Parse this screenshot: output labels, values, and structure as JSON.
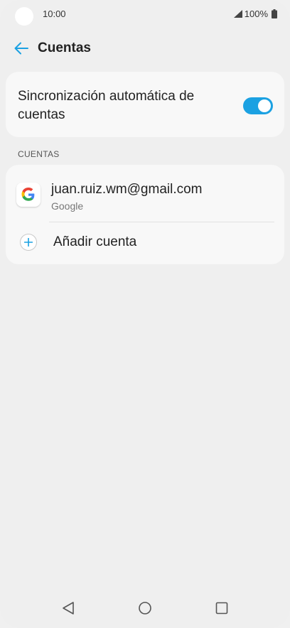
{
  "status_bar": {
    "time": "10:00",
    "battery": "100%",
    "icons": [
      "signal-icon",
      "battery-icon"
    ]
  },
  "header": {
    "title": "Cuentas",
    "back_icon": "arrow-left-icon"
  },
  "sync": {
    "label": "Sincronización automática de cuentas",
    "enabled": true
  },
  "accounts_section": {
    "header": "CUENTAS",
    "accounts": [
      {
        "email": "juan.ruiz.wm@gmail.com",
        "type": "Google",
        "icon": "google-icon"
      }
    ],
    "add_label": "Añadir cuenta"
  },
  "nav": {
    "icons": [
      "back-triangle-icon",
      "home-circle-icon",
      "recents-square-icon"
    ]
  },
  "colors": {
    "accent": "#1ba1e2",
    "background": "#efefef",
    "card": "#f8f8f8"
  }
}
